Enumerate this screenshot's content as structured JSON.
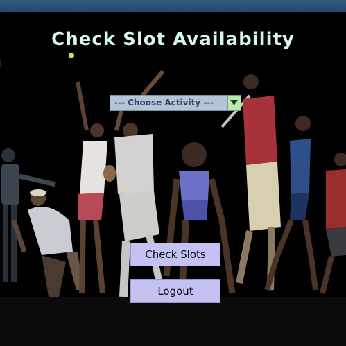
{
  "page": {
    "title": "Check Slot Availability"
  },
  "activity_select": {
    "selected": "--- Choose Activity ---"
  },
  "actions": {
    "check_slots_label": "Check Slots",
    "logout_label": "Logout"
  },
  "colors": {
    "title_text": "#d8f7ec",
    "background": "#000000",
    "select_background": "#b3c5d6",
    "select_arrow_background": "#b8ebb0",
    "button_background": "#c4c2f3",
    "titlebar": "#2f5a80"
  },
  "icons": {
    "select_arrow": "triangle-down-icon"
  }
}
